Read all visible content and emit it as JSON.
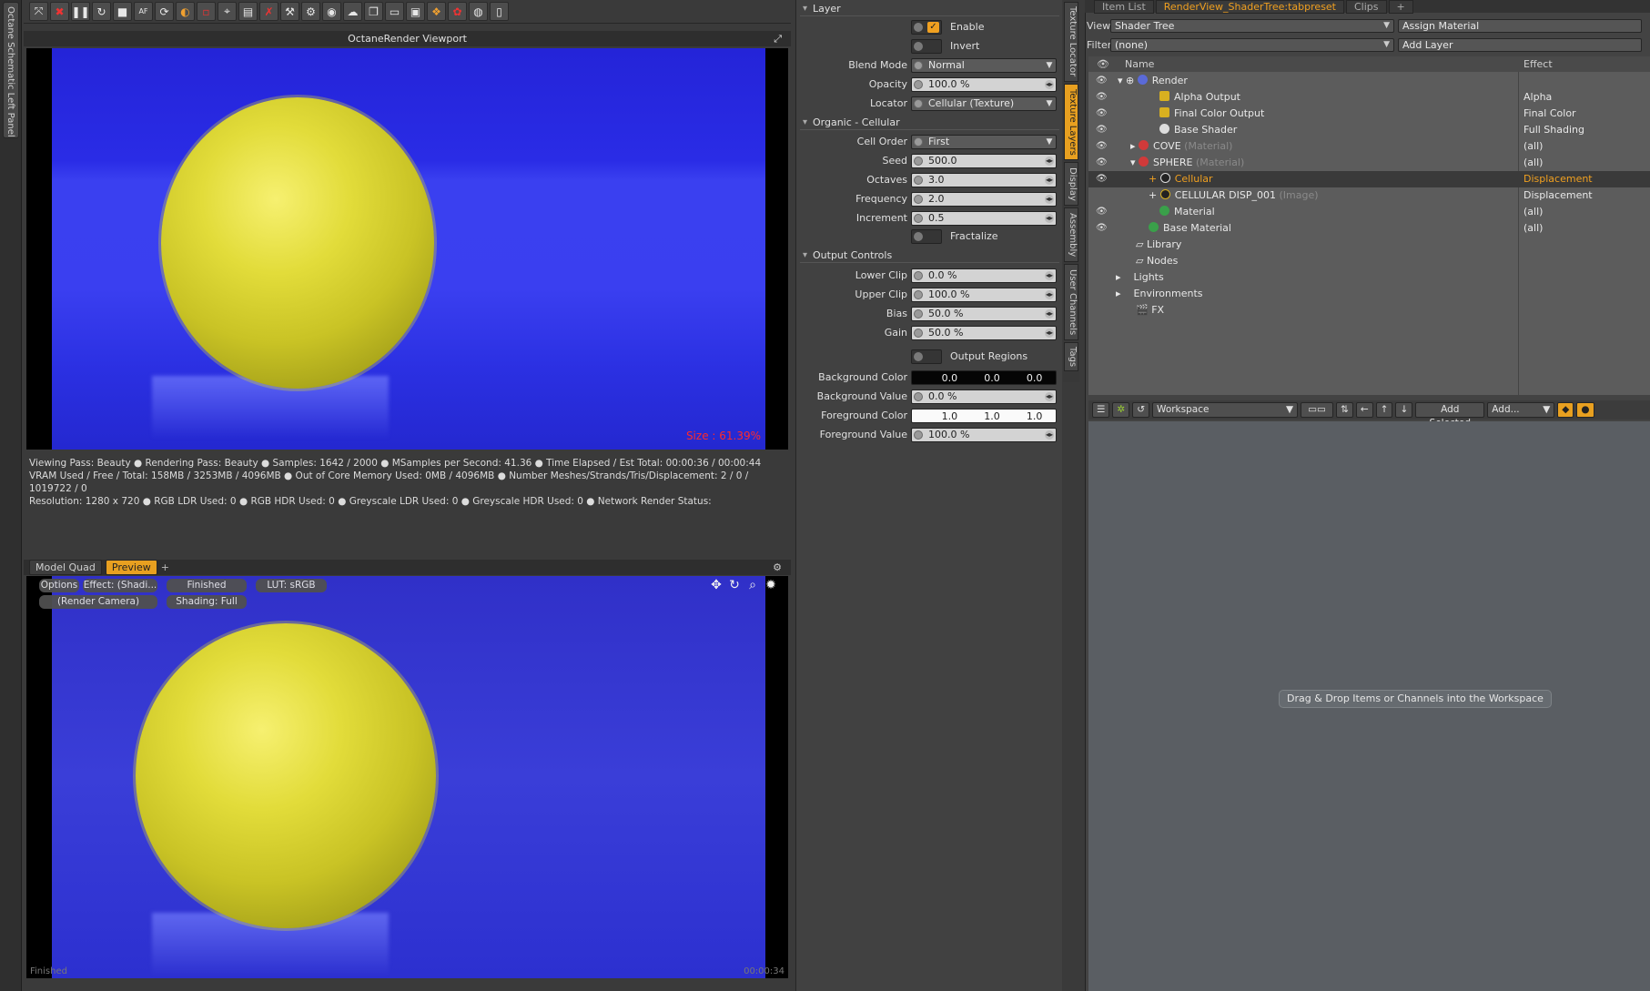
{
  "left_panel": {
    "label": "Octane Schematic Left Panel"
  },
  "toolbar": {
    "buttons": [
      "expand-icon",
      "stop-icon",
      "pause-icon",
      "restart-icon",
      "square-stop-icon",
      "af-icon",
      "reload-icon",
      "color-icon",
      "region-icon",
      "picker-icon",
      "film-icon",
      "clear-icon",
      "tool-icon",
      "settings-icon",
      "camera-icon",
      "cloud-icon",
      "layers-icon",
      "terminal-icon",
      "image-icon",
      "gallery-icon",
      "palette-icon",
      "globe-icon",
      "doc-icon"
    ]
  },
  "viewport_top": {
    "title": "OctaneRender Viewport",
    "size_label": "Size : 61.39%"
  },
  "status": {
    "line1": "Viewing Pass: Beauty ● Rendering Pass: Beauty ● Samples: 1642 / 2000 ● MSamples per Second: 41.36 ● Time Elapsed / Est Total: 00:00:36 / 00:00:44",
    "line2": "VRAM Used / Free / Total: 158MB / 3253MB / 4096MB ● Out of Core Memory Used: 0MB / 4096MB ● Number Meshes/Strands/Tris/Displacement: 2 / 0 / 1019722 / 0",
    "line3": "Resolution: 1280 x 720 ● RGB LDR Used: 0 ● RGB HDR Used: 0 ● Greyscale LDR Used: 0 ● Greyscale HDR Used: 0 ● Network Render Status:"
  },
  "viewport_bottom": {
    "tabs": [
      "Model Quad",
      "Preview",
      "+"
    ],
    "options": "Options",
    "effect": "Effect: (Shadi...",
    "finished": "Finished",
    "lut": "LUT: sRGB",
    "camera": "(Render Camera)",
    "shading": "Shading: Full",
    "footer_left": "Finished",
    "footer_right": "00:00:34"
  },
  "properties": {
    "layer_header": "Layer",
    "enable": "Enable",
    "invert": "Invert",
    "blend_mode_label": "Blend Mode",
    "blend_mode_value": "Normal",
    "opacity_label": "Opacity",
    "opacity_value": "100.0 %",
    "locator_label": "Locator",
    "locator_value": "Cellular (Texture)",
    "organic_header": "Organic - Cellular",
    "cell_order_label": "Cell Order",
    "cell_order_value": "First",
    "seed_label": "Seed",
    "seed_value": "500.0",
    "octaves_label": "Octaves",
    "octaves_value": "3.0",
    "frequency_label": "Frequency",
    "frequency_value": "2.0",
    "increment_label": "Increment",
    "increment_value": "0.5",
    "fractalize": "Fractalize",
    "output_header": "Output Controls",
    "lower_clip_label": "Lower Clip",
    "lower_clip_value": "0.0 %",
    "upper_clip_label": "Upper Clip",
    "upper_clip_value": "100.0 %",
    "bias_label": "Bias",
    "bias_value": "50.0 %",
    "gain_label": "Gain",
    "gain_value": "50.0 %",
    "output_regions": "Output Regions",
    "bg_color_label": "Background Color",
    "bg_color_values": [
      "0.0",
      "0.0",
      "0.0"
    ],
    "bg_value_label": "Background Value",
    "bg_value_value": "0.0 %",
    "fg_color_label": "Foreground Color",
    "fg_color_values": [
      "1.0",
      "1.0",
      "1.0"
    ],
    "fg_value_label": "Foreground Value",
    "fg_value_value": "100.0 %"
  },
  "side_tabs": [
    "Texture Locator",
    "Texture Layers",
    "Display",
    "Assembly",
    "User Channels",
    "Tags"
  ],
  "right": {
    "tabs": [
      "Item List",
      "RenderView_ShaderTree:tabpreset",
      "Clips",
      "+"
    ],
    "view_label": "View",
    "view_value": "Shader Tree",
    "assign_material": "Assign Material",
    "filter_label": "Filter",
    "filter_value": "(none)",
    "add_layer": "Add Layer",
    "col_name": "Name",
    "col_effect": "Effect",
    "tree": [
      {
        "name": "Render",
        "dim": "",
        "effect": "",
        "icon": "#5a6ad8"
      },
      {
        "name": "Alpha Output",
        "dim": "",
        "effect": "Alpha",
        "icon": "#d8b020"
      },
      {
        "name": "Final Color Output",
        "dim": "",
        "effect": "Final Color",
        "icon": "#d8b020"
      },
      {
        "name": "Base Shader",
        "dim": "",
        "effect": "Full Shading",
        "icon": "#dddddd"
      },
      {
        "name": "COVE",
        "dim": "(Material)",
        "effect": "(all)",
        "icon": "#d03a3a"
      },
      {
        "name": "SPHERE",
        "dim": "(Material)",
        "effect": "(all)",
        "icon": "#d03a3a"
      },
      {
        "name": "Cellular",
        "dim": "",
        "effect": "Displacement",
        "icon": "#222222"
      },
      {
        "name": "CELLULAR DISP_001",
        "dim": "(Image)",
        "effect": "Displacement",
        "icon": "#222222"
      },
      {
        "name": "Material",
        "dim": "",
        "effect": "(all)",
        "icon": "#3aa04a"
      },
      {
        "name": "Base Material",
        "dim": "",
        "effect": "(all)",
        "icon": "#3aa04a"
      },
      {
        "name": "Library",
        "dim": "",
        "effect": "",
        "icon": ""
      },
      {
        "name": "Nodes",
        "dim": "",
        "effect": "",
        "icon": ""
      },
      {
        "name": "Lights",
        "dim": "",
        "effect": "",
        "icon": ""
      },
      {
        "name": "Environments",
        "dim": "",
        "effect": "",
        "icon": ""
      },
      {
        "name": "FX",
        "dim": "",
        "effect": "",
        "icon": ""
      }
    ],
    "workspace_value": "Workspace",
    "add_selected": "Add Selected",
    "add_menu": "Add...",
    "workspace_msg": "Drag & Drop Items or Channels into the Workspace"
  }
}
